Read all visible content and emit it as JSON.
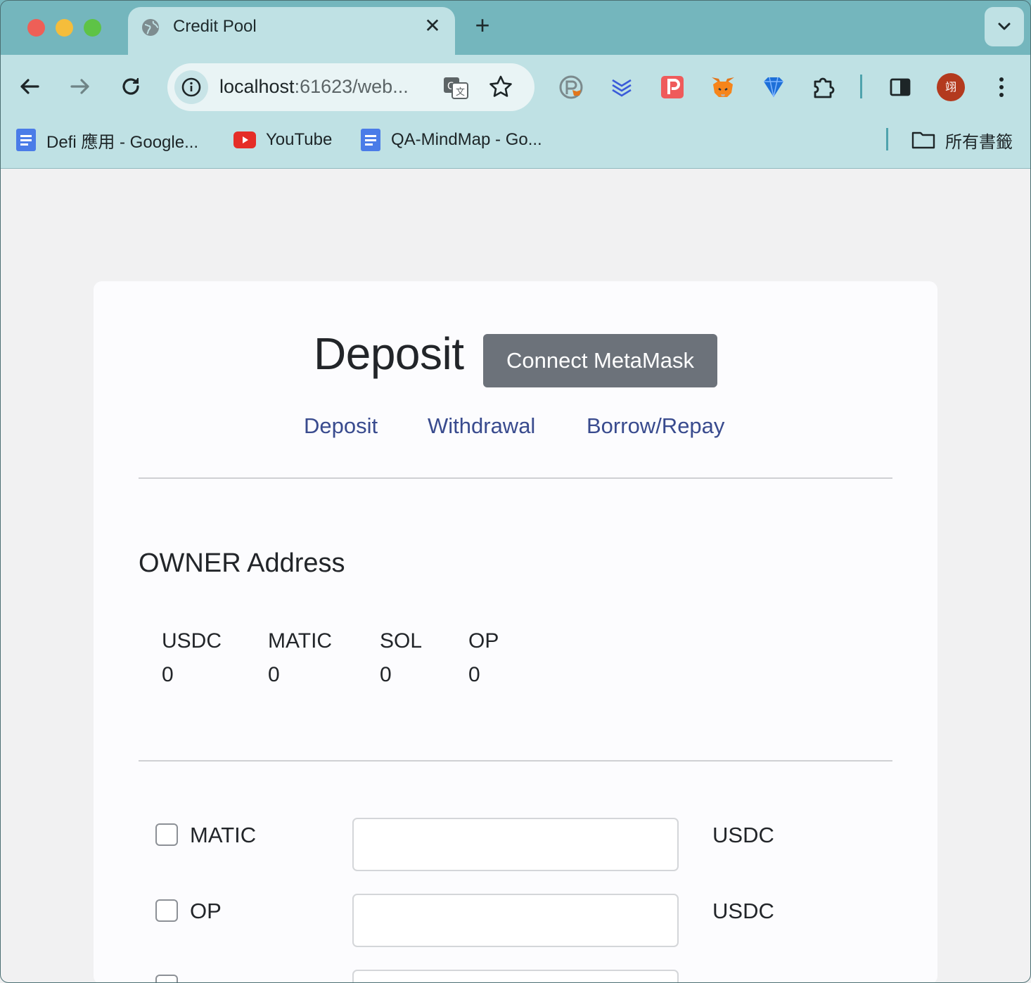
{
  "browser": {
    "tab_title": "Credit Pool",
    "url_host": "localhost",
    "url_rest": ":61623/web...",
    "avatar_initial": "翊",
    "bookmarks": [
      {
        "label": "Defi 應用 - Google...",
        "icon": "google-docs-icon"
      },
      {
        "label": "YouTube",
        "icon": "youtube-icon"
      },
      {
        "label": "QA-MindMap - Go...",
        "icon": "google-docs-icon"
      }
    ],
    "all_bookmarks_label": "所有書籤"
  },
  "page": {
    "title": "Deposit",
    "connect_button": "Connect MetaMask",
    "nav": [
      {
        "label": "Deposit"
      },
      {
        "label": "Withdrawal"
      },
      {
        "label": "Borrow/Repay"
      }
    ],
    "owner_label": "OWNER Address",
    "balances": [
      {
        "token": "USDC",
        "value": "0"
      },
      {
        "token": "MATIC",
        "value": "0"
      },
      {
        "token": "SOL",
        "value": "0"
      },
      {
        "token": "OP",
        "value": "0"
      }
    ],
    "deposits": [
      {
        "asset": "MATIC",
        "value": "",
        "unit": "USDC",
        "checked": false
      },
      {
        "asset": "OP",
        "value": "",
        "unit": "USDC",
        "checked": false
      }
    ]
  },
  "colors": {
    "tabstrip": "#74b6bd",
    "toolbar": "#bfe1e4",
    "button": "#6c727a",
    "link": "#394b8e"
  }
}
